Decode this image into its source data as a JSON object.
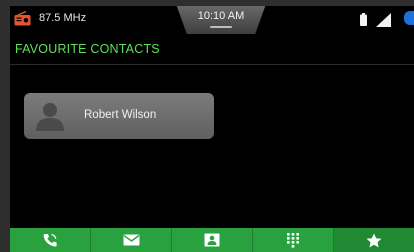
{
  "status": {
    "radio_frequency": "87.5 MHz",
    "time": "10:10 AM",
    "icons": [
      "radio-icon",
      "battery-icon",
      "signal-icon",
      "bluetooth-icon"
    ]
  },
  "header": {
    "title": "FAVOURITE CONTACTS"
  },
  "contacts": [
    {
      "name": "Robert Wilson",
      "icon": "person-icon"
    }
  ],
  "bottom_nav": {
    "items": [
      {
        "icon": "phone-icon",
        "active": false
      },
      {
        "icon": "message-icon",
        "active": false
      },
      {
        "icon": "contacts-icon",
        "active": false
      },
      {
        "icon": "dialpad-icon",
        "active": false
      },
      {
        "icon": "favourites-icon",
        "active": true
      }
    ]
  },
  "colors": {
    "accent": "#5fe05a",
    "nav_bar": "#2aa13f",
    "nav_active": "#1f8a33",
    "card": "#6e6e6e"
  }
}
